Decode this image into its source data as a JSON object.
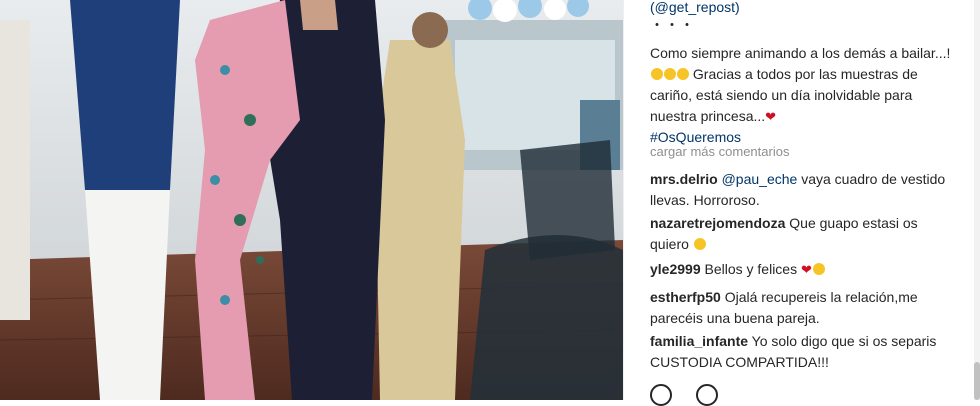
{
  "post": {
    "repost_tag": "(@get_repost)",
    "dots": "・・・",
    "caption_main": "Como siempre animando a los demás a bailar...!",
    "caption_rest": " Gracias a todos por las muestras de cariño, está siendo un día inolvidable para nuestra princesa...",
    "hashtag": "#OsQueremos"
  },
  "comments_section": {
    "load_more": "cargar más comentarios",
    "items": [
      {
        "user": "mrs.delrio",
        "mention": "@pau_eche",
        "text": " vaya cuadro de vestido llevas. Horroroso."
      },
      {
        "user": "nazaretrejomendoza",
        "text": " Que guapo estasi os quiero"
      },
      {
        "user": "yle2999",
        "text": " Bellos y felices"
      },
      {
        "user": "estherfp50",
        "text": " Ojalá recupereis la relación,me parecéis una buena pareja."
      },
      {
        "user": "familia_infante",
        "text": " Yo solo digo que si os separis CUSTODIA COMPARTIDA!!!"
      }
    ]
  },
  "icons": {
    "like": "heart-outline-icon",
    "comment": "speech-bubble-icon"
  },
  "colors": {
    "text": "#262626",
    "link": "#003569",
    "muted": "#8e8e8e",
    "dress": "#e59bb0",
    "suit": "#1d2035"
  }
}
